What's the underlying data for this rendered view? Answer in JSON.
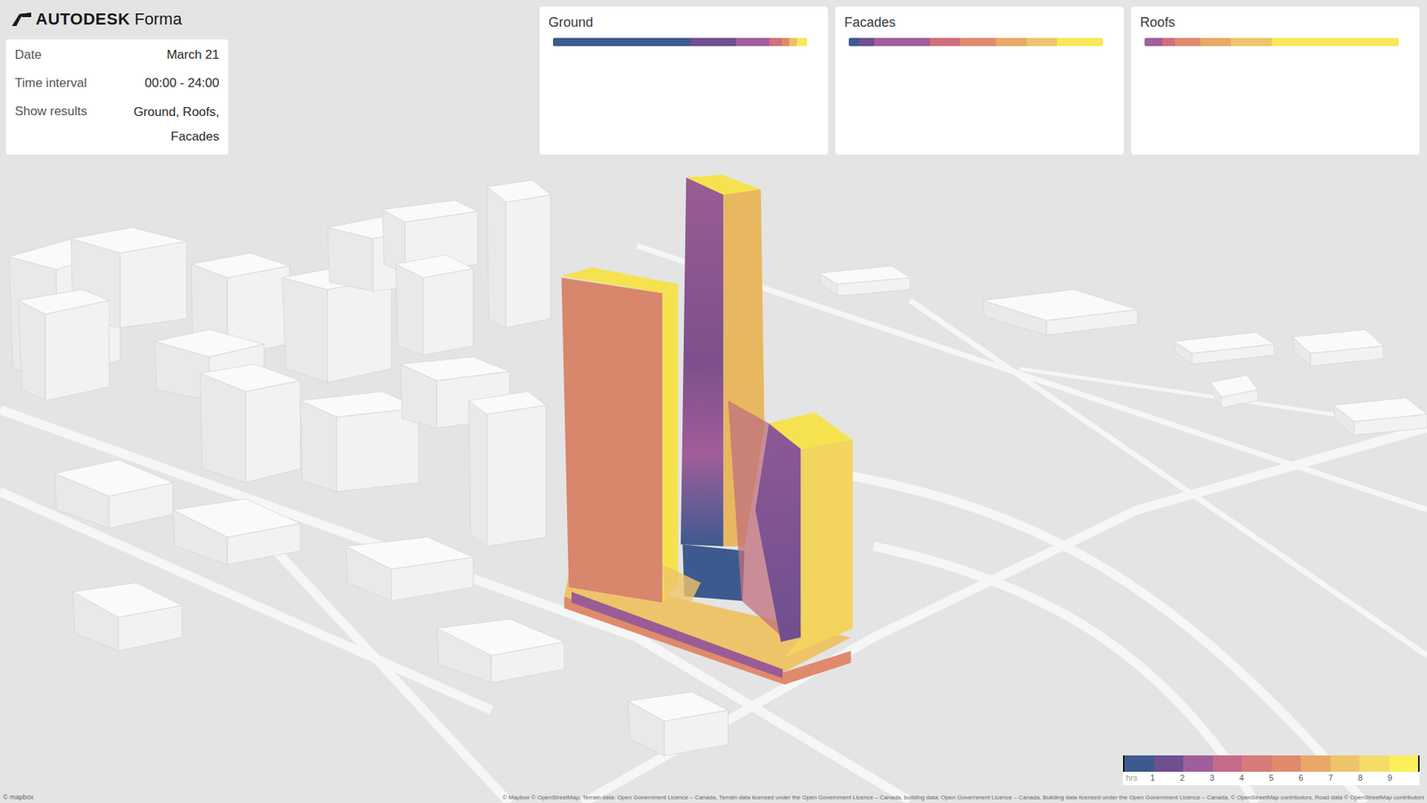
{
  "app": {
    "brand": "AUTODESK",
    "product": "Forma"
  },
  "info": [
    {
      "label": "Date",
      "value": "March 21"
    },
    {
      "label": "Time interval",
      "value": "00:00 - 24:00"
    },
    {
      "label": "Show results",
      "value": "Ground, Roofs, Facades"
    }
  ],
  "legends": [
    {
      "title": "Ground",
      "segments": [
        {
          "color": "#3d5a8e",
          "level": 0.54
        },
        {
          "color": "#6f4f8e",
          "level": 0.18
        },
        {
          "color": "#a15e9c",
          "level": 0.13
        },
        {
          "color": "#d0707c",
          "level": 0.05
        },
        {
          "color": "#e08a6c",
          "level": 0.03
        },
        {
          "color": "#eac066",
          "level": 0.03
        },
        {
          "color": "#f8e85a",
          "level": 0.04
        }
      ]
    },
    {
      "title": "Facades",
      "segments": [
        {
          "color": "#3d5a8e",
          "level": 0.04
        },
        {
          "color": "#6f4f8e",
          "level": 0.06
        },
        {
          "color": "#a15e9c",
          "level": 0.22
        },
        {
          "color": "#d0707c",
          "level": 0.12
        },
        {
          "color": "#e08a6c",
          "level": 0.14
        },
        {
          "color": "#e8a868",
          "level": 0.12
        },
        {
          "color": "#eec46a",
          "level": 0.12
        },
        {
          "color": "#f8e85a",
          "level": 0.18
        }
      ]
    },
    {
      "title": "Roofs",
      "segments": [
        {
          "color": "#a15e9c",
          "level": 0.07
        },
        {
          "color": "#d0707c",
          "level": 0.05
        },
        {
          "color": "#e08a6c",
          "level": 0.1
        },
        {
          "color": "#e8a868",
          "level": 0.12
        },
        {
          "color": "#eec46a",
          "level": 0.16
        },
        {
          "color": "#f8e85a",
          "level": 0.5
        }
      ]
    }
  ],
  "scale": {
    "unit": "hrs",
    "ticks": [
      "1",
      "2",
      "3",
      "4",
      "5",
      "6",
      "7",
      "8",
      "9"
    ],
    "colors": [
      "#3d5a8e",
      "#6f4f8e",
      "#a15e9c",
      "#c66a8a",
      "#d87a78",
      "#e08a6c",
      "#e8a868",
      "#eec46a",
      "#f4dc6a",
      "#fbef5a"
    ]
  },
  "map_credit": "© mapbox",
  "attribution": "© Mapbox © OpenStreetMap, Terrain data: Open Government Licence – Canada, Terrain data licensed under the Open Government Licence – Canada, building data: Open Government Licence – Canada, Building data licensed under the Open Government Licence – Canada, © OpenStreetMap contributors, Road data © OpenStreetMap contributors"
}
